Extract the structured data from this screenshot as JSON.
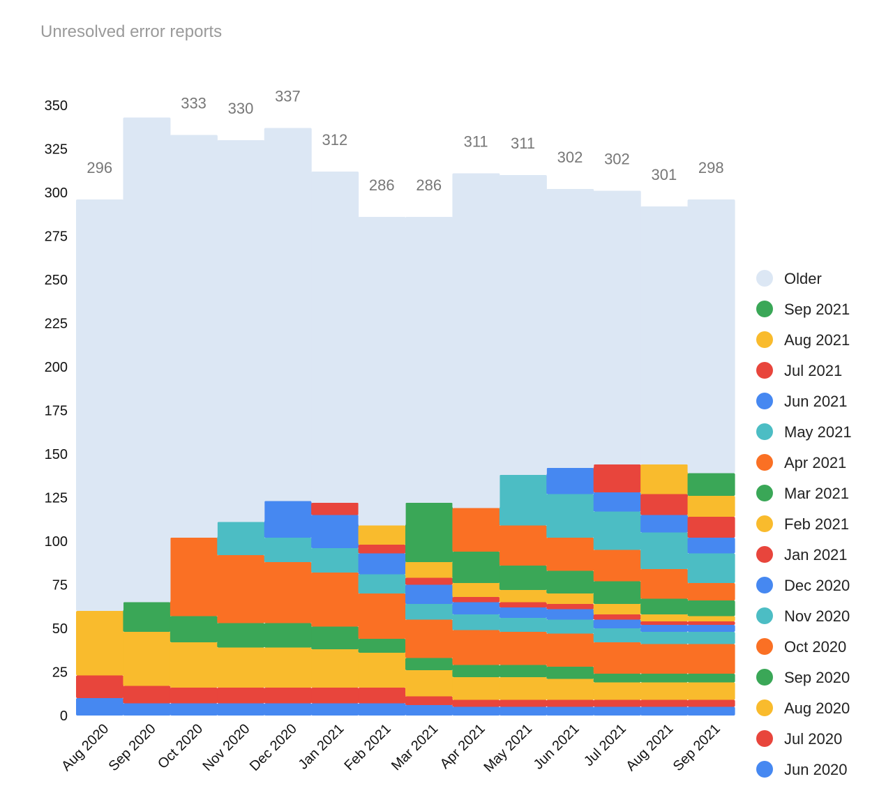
{
  "chart_data": {
    "type": "area",
    "subtype": "stacked-step",
    "title": "Unresolved error reports",
    "xlabel": "",
    "ylabel": "",
    "ylim": [
      0,
      350
    ],
    "yticks": [
      0,
      25,
      50,
      75,
      100,
      125,
      150,
      175,
      200,
      225,
      250,
      275,
      300,
      325,
      350
    ],
    "grid": false,
    "legend_position": "right",
    "categories": [
      "Aug 2020",
      "Sep 2020",
      "Oct 2020",
      "Nov 2020",
      "Dec 2020",
      "Jan 2021",
      "Feb 2021",
      "Mar 2021",
      "Apr 2021",
      "May 2021",
      "Jun 2021",
      "Jul 2021",
      "Aug 2021",
      "Sep 2021"
    ],
    "totals": [
      296,
      null,
      333,
      330,
      337,
      312,
      286,
      286,
      311,
      311,
      302,
      302,
      301,
      298
    ],
    "total_labels": [
      "296",
      "",
      "333",
      "330",
      "337",
      "312",
      "286",
      "286",
      "311",
      "311",
      "302",
      "302",
      "301",
      "298"
    ],
    "series": [
      {
        "name": "Jun 2020",
        "color": "#4688F1",
        "values": [
          10,
          7,
          7,
          7,
          7,
          7,
          7,
          6,
          5,
          5,
          5,
          5,
          5,
          5
        ]
      },
      {
        "name": "Jul 2020",
        "color": "#E8453C",
        "values": [
          13,
          10,
          9,
          9,
          9,
          9,
          9,
          5,
          4,
          4,
          4,
          4,
          4,
          4
        ]
      },
      {
        "name": "Aug 2020",
        "color": "#F9BB2D",
        "values": [
          37,
          31,
          26,
          23,
          23,
          22,
          20,
          15,
          13,
          13,
          12,
          10,
          10,
          10
        ]
      },
      {
        "name": "Sep 2020",
        "color": "#3AA757",
        "values": [
          0,
          17,
          15,
          14,
          14,
          13,
          8,
          7,
          7,
          7,
          7,
          5,
          5,
          5
        ]
      },
      {
        "name": "Oct 2020",
        "color": "#FA7024",
        "values": [
          0,
          0,
          45,
          39,
          35,
          31,
          26,
          22,
          20,
          19,
          19,
          18,
          17,
          17
        ]
      },
      {
        "name": "Nov 2020",
        "color": "#4CBDC4",
        "values": [
          0,
          0,
          0,
          19,
          14,
          14,
          11,
          9,
          9,
          8,
          8,
          8,
          7,
          7
        ]
      },
      {
        "name": "Dec 2020",
        "color": "#4688F1",
        "values": [
          0,
          0,
          0,
          0,
          21,
          19,
          12,
          11,
          7,
          6,
          6,
          5,
          4,
          4
        ]
      },
      {
        "name": "Jan 2021",
        "color": "#E8453C",
        "values": [
          0,
          0,
          0,
          0,
          0,
          7,
          5,
          4,
          3,
          3,
          3,
          3,
          2,
          2
        ]
      },
      {
        "name": "Feb 2021",
        "color": "#F9BB2D",
        "values": [
          0,
          0,
          0,
          0,
          0,
          0,
          11,
          9,
          8,
          7,
          6,
          6,
          4,
          3
        ]
      },
      {
        "name": "Mar 2021",
        "color": "#3AA757",
        "values": [
          0,
          0,
          0,
          0,
          0,
          0,
          0,
          34,
          18,
          14,
          13,
          13,
          9,
          9
        ]
      },
      {
        "name": "Apr 2021",
        "color": "#FA7024",
        "values": [
          0,
          0,
          0,
          0,
          0,
          0,
          0,
          0,
          25,
          23,
          19,
          18,
          17,
          10
        ]
      },
      {
        "name": "May 2021",
        "color": "#4CBDC4",
        "values": [
          0,
          0,
          0,
          0,
          0,
          0,
          0,
          0,
          0,
          29,
          25,
          22,
          21,
          17
        ]
      },
      {
        "name": "Jun 2021",
        "color": "#4688F1",
        "values": [
          0,
          0,
          0,
          0,
          0,
          0,
          0,
          0,
          0,
          0,
          15,
          11,
          10,
          9
        ]
      },
      {
        "name": "Jul 2021",
        "color": "#E8453C",
        "values": [
          0,
          0,
          0,
          0,
          0,
          0,
          0,
          0,
          0,
          0,
          0,
          16,
          12,
          12
        ]
      },
      {
        "name": "Aug 2021",
        "color": "#F9BB2D",
        "values": [
          0,
          0,
          0,
          0,
          0,
          0,
          0,
          0,
          0,
          0,
          0,
          0,
          17,
          12
        ]
      },
      {
        "name": "Sep 2021",
        "color": "#3AA757",
        "values": [
          0,
          0,
          0,
          0,
          0,
          0,
          0,
          0,
          0,
          0,
          0,
          0,
          0,
          13
        ]
      },
      {
        "name": "Older",
        "color": "#DCE7F4",
        "values": [
          236,
          278,
          231,
          219,
          214,
          190,
          177,
          164,
          192,
          172,
          160,
          157,
          148,
          157
        ]
      }
    ],
    "legend": [
      "Older",
      "Sep 2021",
      "Aug 2021",
      "Jul 2021",
      "Jun 2021",
      "May 2021",
      "Apr 2021",
      "Mar 2021",
      "Feb 2021",
      "Jan 2021",
      "Dec 2020",
      "Nov 2020",
      "Oct 2020",
      "Sep 2020",
      "Aug 2020",
      "Jul 2020",
      "Jun 2020"
    ]
  }
}
